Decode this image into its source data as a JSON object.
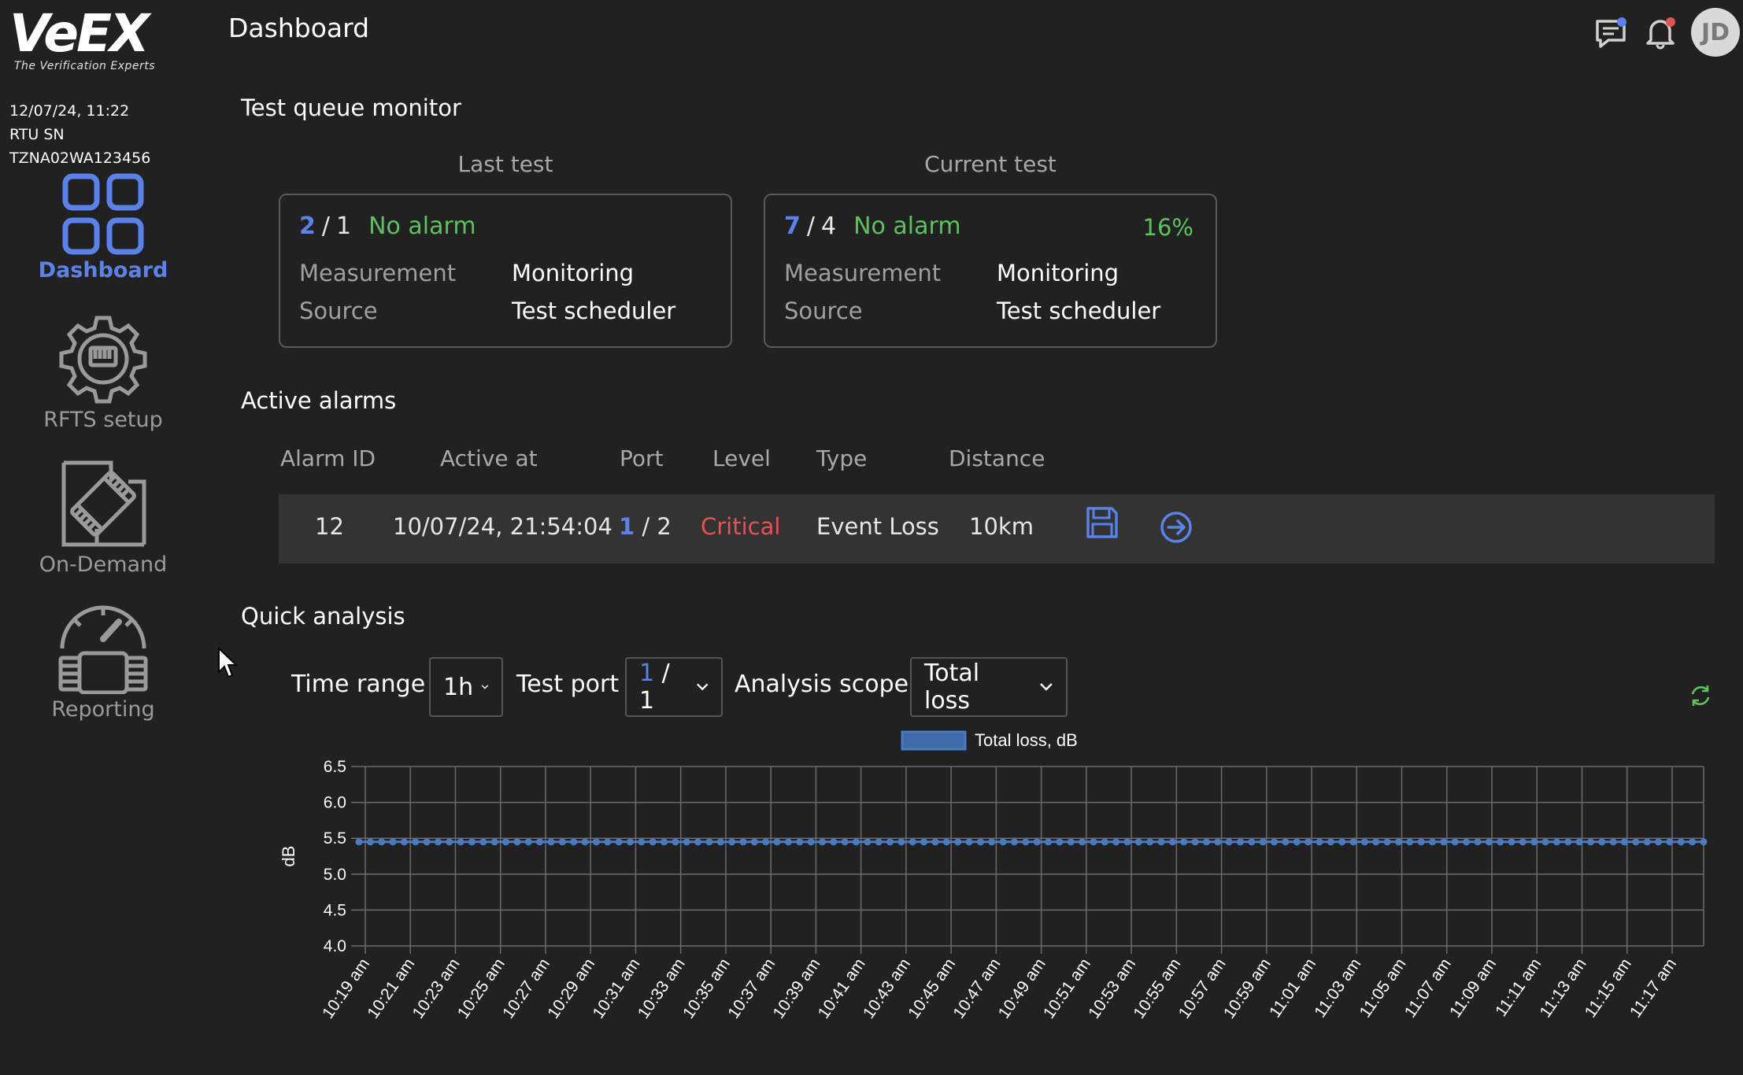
{
  "app": {
    "logo_text": "VeEX",
    "logo_tagline": "The Verification Experts",
    "datetime": "12/07/24, 11:22",
    "rtu_sn": "RTU SN TZNA02WA123456",
    "page_title": "Dashboard"
  },
  "sidebar": {
    "items": [
      {
        "label": "Dashboard",
        "icon": "dashboard-grid-icon",
        "active": true
      },
      {
        "label": "RFTS setup",
        "icon": "gear-icon",
        "active": false
      },
      {
        "label": "On-Demand",
        "icon": "otdr-device-icon",
        "active": false
      },
      {
        "label": "Reporting",
        "icon": "gauge-icon",
        "active": false
      }
    ]
  },
  "header": {
    "avatar_initials": "JD",
    "message_dot_color": "#5b82e8",
    "bell_dot_color": "#e35353"
  },
  "test_queue": {
    "title": "Test queue monitor",
    "last": {
      "heading": "Last test",
      "num_a": "2",
      "sep": "/",
      "num_b": "1",
      "status": "No alarm",
      "measurement_label": "Measurement",
      "measurement_value": "Monitoring",
      "source_label": "Source",
      "source_value": "Test scheduler"
    },
    "current": {
      "heading": "Current test",
      "num_a": "7",
      "sep": "/",
      "num_b": "4",
      "status": "No alarm",
      "progress": "16%",
      "measurement_label": "Measurement",
      "measurement_value": "Monitoring",
      "source_label": "Source",
      "source_value": "Test scheduler"
    }
  },
  "alarms": {
    "title": "Active alarms",
    "columns": [
      "Alarm ID",
      "Active at",
      "Port",
      "Level",
      "Type",
      "Distance"
    ],
    "rows": [
      {
        "id": "12",
        "active_at": "10/07/24, 21:54:04",
        "port_a": "1",
        "port_sep": "/",
        "port_b": "2",
        "level": "Critical",
        "type": "Event Loss",
        "distance": "10km"
      }
    ]
  },
  "quick_analysis": {
    "title": "Quick analysis",
    "time_range_label": "Time range",
    "time_range_value": "1h",
    "test_port_label": "Test port",
    "test_port_a": "1",
    "test_port_sep": "/",
    "test_port_b": "1",
    "scope_label": "Analysis scope",
    "scope_value": "Total loss"
  },
  "colors": {
    "accent": "#5b82e8",
    "ok": "#5fc05f",
    "critical": "#e35353",
    "series": "#4a7bc0"
  },
  "chart_data": {
    "type": "line",
    "legend": [
      "Total loss, dB"
    ],
    "ylabel": "dB",
    "ylim": [
      4.0,
      6.5
    ],
    "yticks": [
      4.0,
      4.5,
      5.0,
      5.5,
      6.0,
      6.5
    ],
    "x_tick_labels": [
      "10:19 am",
      "10:21 am",
      "10:23 am",
      "10:25 am",
      "10:27 am",
      "10:29 am",
      "10:31 am",
      "10:33 am",
      "10:35 am",
      "10:37 am",
      "10:39 am",
      "10:41 am",
      "10:43 am",
      "10:45 am",
      "10:47 am",
      "10:49 am",
      "10:51 am",
      "10:53 am",
      "10:55 am",
      "10:57 am",
      "10:59 am",
      "11:01 am",
      "11:03 am",
      "11:05 am",
      "11:07 am",
      "11:09 am",
      "11:11 am",
      "11:13 am",
      "11:15 am",
      "11:17 am"
    ],
    "series": [
      {
        "name": "Total loss, dB",
        "value": 5.45,
        "point_count": 120
      }
    ],
    "grid": true,
    "legend_position": "top-center"
  }
}
